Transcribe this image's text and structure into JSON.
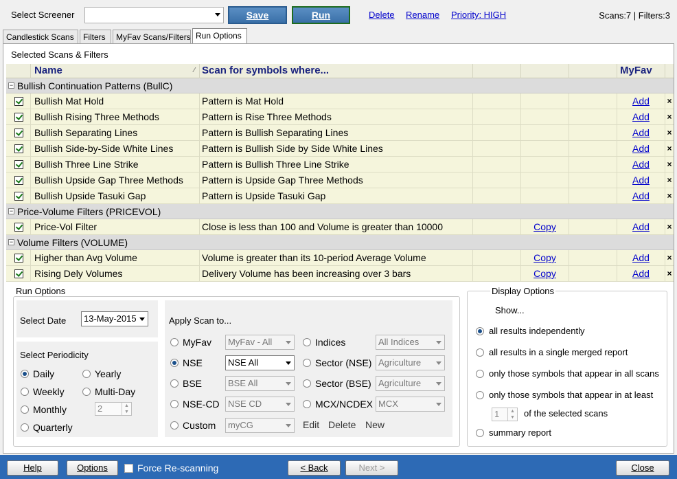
{
  "topbar": {
    "select_label": "Select Screener",
    "screener_value": "",
    "save_label": "Save",
    "run_label": "Run",
    "delete_label": "Delete",
    "rename_label": "Rename",
    "priority_label": "Priority: HIGH",
    "counts": "Scans:7 | Filters:3"
  },
  "tabs": [
    "Candlestick Scans",
    "Filters",
    "MyFav Scans/Filters",
    "Run Options"
  ],
  "selected_title": "Selected Scans & Filters",
  "grid": {
    "headers": {
      "name": "Name",
      "scan_for": "Scan for symbols where...",
      "myfav": "MyFav"
    },
    "groups": [
      {
        "title": "Bullish Continuation Patterns (BullC)",
        "rows": [
          {
            "name": "Bullish Mat Hold",
            "criteria": "Pattern is Mat Hold",
            "copy": "",
            "add": "Add"
          },
          {
            "name": "Bullish Rising Three Methods",
            "criteria": "Pattern is Rise Three Methods",
            "copy": "",
            "add": "Add"
          },
          {
            "name": "Bullish Separating Lines",
            "criteria": "Pattern is Bullish Separating Lines",
            "copy": "",
            "add": "Add"
          },
          {
            "name": "Bullish Side-by-Side White Lines",
            "criteria": "Pattern is Bullish Side by Side White Lines",
            "copy": "",
            "add": "Add"
          },
          {
            "name": "Bullish Three Line Strike",
            "criteria": "Pattern is Bullish Three Line Strike",
            "copy": "",
            "add": "Add"
          },
          {
            "name": "Bullish Upside Gap Three Methods",
            "criteria": "Pattern is Upside Gap Three Methods",
            "copy": "",
            "add": "Add"
          },
          {
            "name": "Bullish Upside Tasuki Gap",
            "criteria": "Pattern is Upside Tasuki Gap",
            "copy": "",
            "add": "Add"
          }
        ]
      },
      {
        "title": "Price-Volume Filters (PRICEVOL)",
        "rows": [
          {
            "name": "Price-Vol Filter",
            "criteria": "Close is less than 100 and Volume is greater than 10000",
            "copy": "Copy",
            "add": "Add"
          }
        ]
      },
      {
        "title": "Volume Filters (VOLUME)",
        "rows": [
          {
            "name": "Higher than Avg Volume",
            "criteria": "Volume is greater than its 10-period Average Volume",
            "copy": "Copy",
            "add": "Add"
          },
          {
            "name": "Rising Dely Volumes",
            "criteria": "Delivery Volume has been increasing over 3 bars",
            "copy": "Copy",
            "add": "Add"
          }
        ]
      }
    ],
    "remove_glyph": "×"
  },
  "run_options": {
    "title": "Run Options",
    "select_date_label": "Select Date",
    "date_value": "13-May-2015",
    "periodicity_label": "Select Periodicity",
    "periodicity": {
      "daily": "Daily",
      "yearly": "Yearly",
      "weekly": "Weekly",
      "multiday": "Multi-Day",
      "monthly": "Monthly",
      "quarterly": "Quarterly",
      "multiday_value": "2"
    },
    "apply_label": "Apply Scan to...",
    "apply": {
      "myfav": "MyFav",
      "myfav_value": "MyFav - All",
      "nse": "NSE",
      "nse_value": "NSE All",
      "bse": "BSE",
      "bse_value": "BSE All",
      "nsecd": "NSE-CD",
      "nsecd_value": "NSE CD",
      "custom": "Custom",
      "custom_value": "myCG",
      "indices": "Indices",
      "indices_value": "All Indices",
      "sector_nse": "Sector (NSE)",
      "sector_nse_value": "Agriculture",
      "sector_bse": "Sector (BSE)",
      "sector_bse_value": "Agriculture",
      "mcx": "MCX/NCDEX",
      "mcx_value": "MCX",
      "edit": "Edit",
      "delete": "Delete",
      "new": "New"
    }
  },
  "display_options": {
    "title": "Display Options",
    "show_label": "Show...",
    "opt1": "all results independently",
    "opt2": "all results in a single merged report",
    "opt3": "only those symbols that appear in all scans",
    "opt4": "only those symbols that appear in at least",
    "atleast_value": "1",
    "opt4_suffix": "of the selected scans",
    "opt5": "summary report"
  },
  "bottombar": {
    "help": "Help",
    "options": "Options",
    "force": "Force Re-scanning",
    "back": "< Back",
    "next": "Next >",
    "close": "Close"
  },
  "colors": {
    "bottom_bar": "#2d6ab5",
    "row_bg": "#f5f5dc",
    "group_bg": "#dcdcdc",
    "header_text": "#1a237e"
  }
}
